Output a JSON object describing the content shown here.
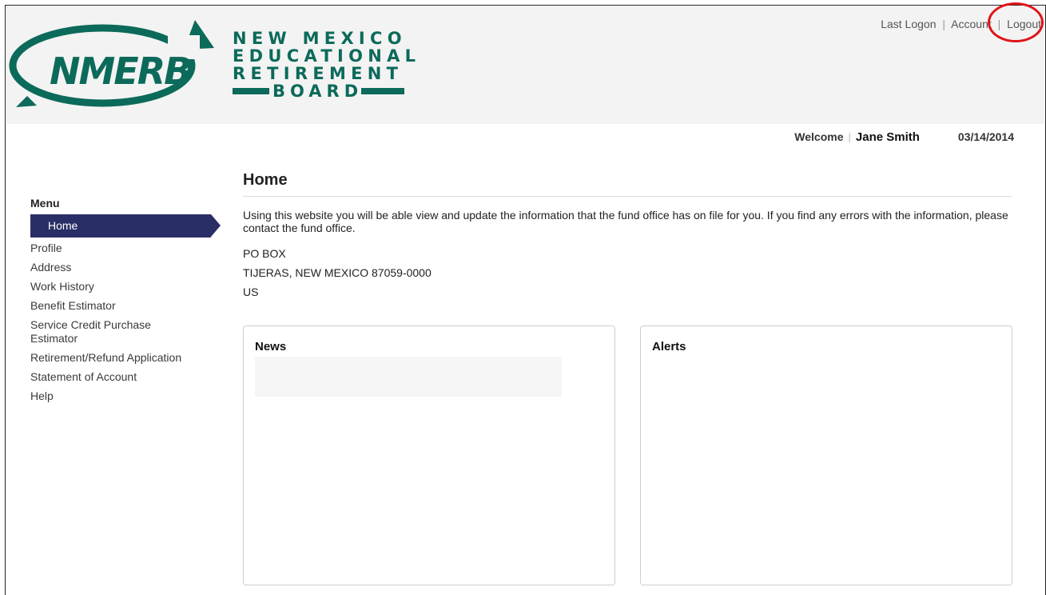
{
  "brand": {
    "logo_text": "NMERB",
    "wordmark": [
      "NEW MEXICO",
      "EDUCATIONAL",
      "RETIREMENT",
      "BOARD"
    ],
    "color": "#0c6a5a"
  },
  "toplinks": {
    "last_logon": "Last Logon",
    "account": "Account",
    "logout": "Logout",
    "separator": "|"
  },
  "user": {
    "welcome": "Welcome",
    "name": "Jane Smith",
    "date": "03/14/2014"
  },
  "sidebar": {
    "title": "Menu",
    "items": [
      {
        "label": "Home"
      },
      {
        "label": "Profile"
      },
      {
        "label": "Address"
      },
      {
        "label": "Work History"
      },
      {
        "label": "Benefit Estimator"
      },
      {
        "label": "Service Credit Purchase\nEstimator"
      },
      {
        "label": "Retirement/Refund Application"
      },
      {
        "label": "Statement of Account"
      },
      {
        "label": "Help"
      }
    ]
  },
  "main": {
    "title": "Home",
    "intro": "Using this website you will be able view and update the information that the fund office has on file for you. If you find any errors with the information, please contact the fund office.",
    "address": [
      "PO BOX",
      "TIJERAS, NEW MEXICO 87059-0000",
      "US"
    ]
  },
  "panels": {
    "news": "News",
    "alerts": "Alerts"
  },
  "colors": {
    "nav_active": "#2a2e66",
    "highlight_ring": "#e0141a"
  }
}
